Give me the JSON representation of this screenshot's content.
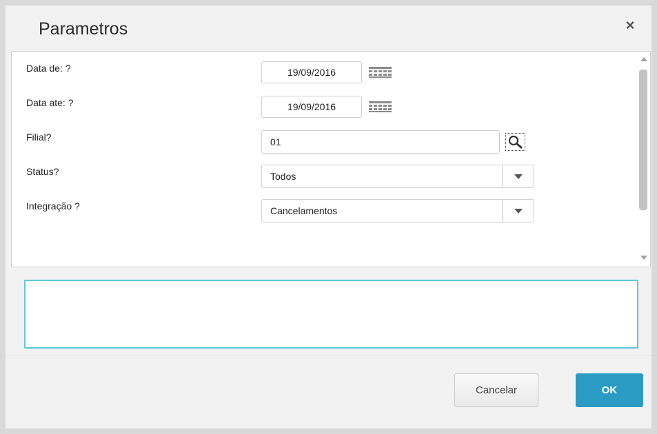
{
  "dialog": {
    "title": "Parametros",
    "close_label": "×"
  },
  "params": {
    "date_from": {
      "label": "Data de: ?",
      "value": "19/09/2016"
    },
    "date_to": {
      "label": "Data ate: ?",
      "value": "19/09/2016"
    },
    "branch": {
      "label": "Filial?",
      "value": "01"
    },
    "status": {
      "label": "Status?",
      "value": "Todos"
    },
    "integration": {
      "label": "Integração ?",
      "value": "Cancelamentos"
    }
  },
  "message": {
    "value": ""
  },
  "footer": {
    "cancel_label": "Cancelar",
    "ok_label": "OK"
  },
  "colors": {
    "accent": "#2a9cc4",
    "focus_border": "#5bc8dc"
  },
  "icons": {
    "calendar": "calendar-icon",
    "search": "search-icon",
    "dropdown": "chevron-down-icon",
    "close": "close-icon"
  }
}
